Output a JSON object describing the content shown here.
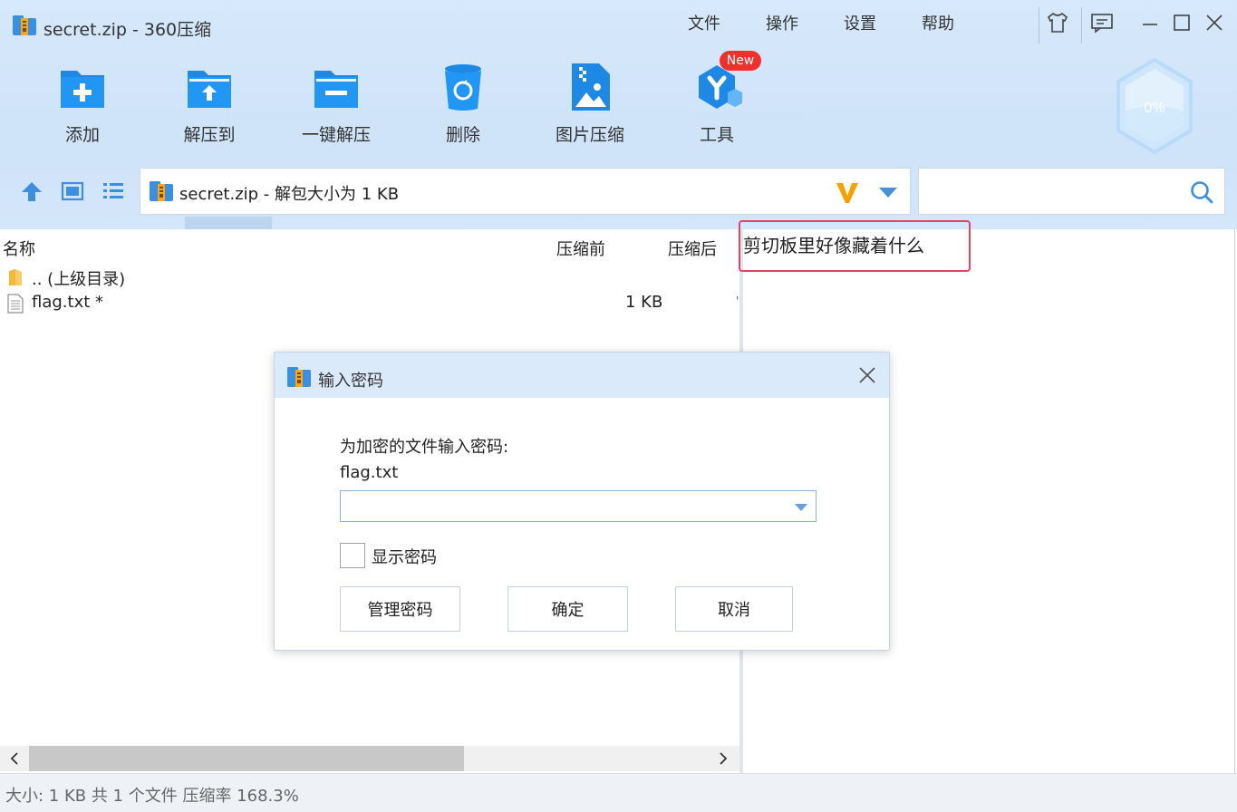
{
  "window": {
    "title": "secret.zip - 360压缩",
    "menus": [
      "文件",
      "操作",
      "设置",
      "帮助"
    ],
    "controls": [
      "skin-icon",
      "feedback-icon",
      "minimize-icon",
      "maximize-icon",
      "close-icon"
    ]
  },
  "toolbar": {
    "items": [
      {
        "label": "添加",
        "icon": "add-folder-icon"
      },
      {
        "label": "解压到",
        "icon": "extract-folder-icon"
      },
      {
        "label": "一键解压",
        "icon": "quick-extract-icon"
      },
      {
        "label": "删除",
        "icon": "recycle-bin-icon"
      },
      {
        "label": "图片压缩",
        "icon": "image-compress-icon"
      },
      {
        "label": "工具",
        "icon": "tools-icon"
      }
    ],
    "new_badge": "New",
    "speed_ball_percent": "0%"
  },
  "address_bar": {
    "text": "secret.zip - 解包大小为 1 KB",
    "search_placeholder": ""
  },
  "file_list": {
    "columns": [
      "名称",
      "压缩前",
      "压缩后"
    ],
    "rows": [
      {
        "name": ".. (上级目录)",
        "size": "",
        "icon": "folder-icon"
      },
      {
        "name": "flag.txt *",
        "size": "1 KB",
        "icon": "text-file-icon"
      }
    ]
  },
  "preview": {
    "text": "剪切板里好像藏着什么"
  },
  "status_bar": {
    "text": "大小: 1 KB 共 1 个文件 压缩率 168.3%"
  },
  "dialog": {
    "title": "输入密码",
    "prompt": "为加密的文件输入密码:",
    "file_name": "flag.txt",
    "password_value": "",
    "show_password_label": "显示密码",
    "show_password_checked": false,
    "buttons": {
      "manage": "管理密码",
      "ok": "确定",
      "cancel": "取消"
    }
  },
  "colors": {
    "accent": "#1e88e5",
    "header_bg": "#d3e6fa",
    "highlight_border": "#e0465e",
    "badge": "#f0302c"
  }
}
